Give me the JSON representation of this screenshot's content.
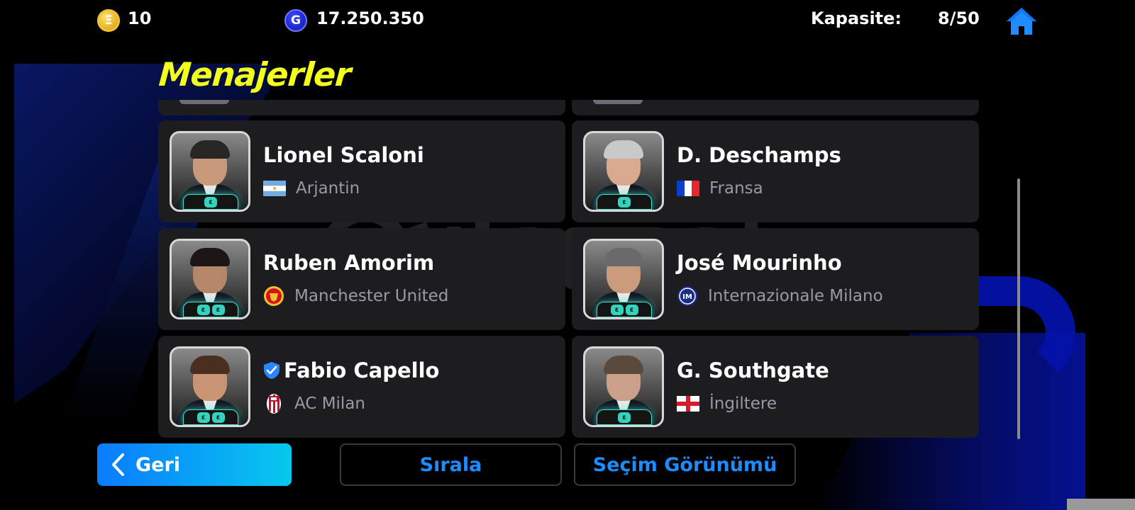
{
  "header": {
    "coins": {
      "icon": "ecoin-icon",
      "value": "10"
    },
    "gp": {
      "icon": "gp-icon",
      "value": "17.250.350"
    },
    "capacity_label": "Kapasite:",
    "capacity_value": "8/50",
    "home_icon": "home-icon"
  },
  "title": "Menajerler",
  "managers": [
    {
      "name": "Lionel Scaloni",
      "team": "Arjantin",
      "badge": "flag-argentina",
      "chips": 1,
      "verified": false
    },
    {
      "name": "D. Deschamps",
      "team": "Fransa",
      "badge": "flag-france",
      "chips": 1,
      "verified": false
    },
    {
      "name": "Ruben Amorim",
      "team": "Manchester United",
      "badge": "manchester-united-crest",
      "chips": 2,
      "verified": false
    },
    {
      "name": "José Mourinho",
      "team": "Internazionale Milano",
      "badge": "inter-milan-crest",
      "chips": 2,
      "verified": false
    },
    {
      "name": "Fabio Capello",
      "team": "AC Milan",
      "badge": "ac-milan-crest",
      "chips": 2,
      "verified": true
    },
    {
      "name": "G. Southgate",
      "team": "İngiltere",
      "badge": "flag-england",
      "chips": 1,
      "verified": false
    }
  ],
  "buttons": {
    "back": "Geri",
    "sort": "Sırala",
    "view": "Seçim Görünümü"
  },
  "colors": {
    "title": "#f4ff1a",
    "accent_blue": "#1d8cff",
    "card_bg": "#1d1d21",
    "chip_teal": "#34d3be"
  }
}
